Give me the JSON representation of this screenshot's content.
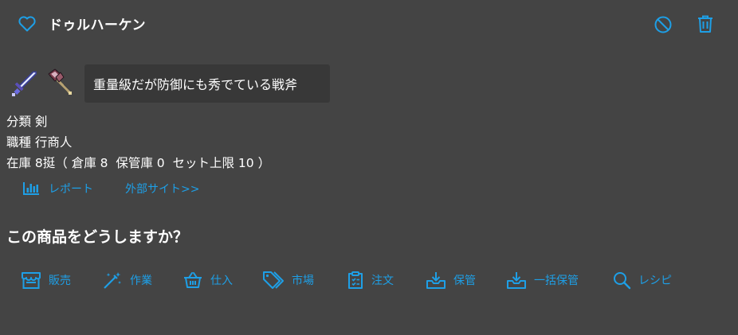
{
  "header": {
    "title": "ドゥルハーケン",
    "favorite_icon": "heart-outline-icon",
    "ban_icon": "ban-icon",
    "delete_icon": "trash-icon"
  },
  "item": {
    "sprites": [
      "sword-sprite",
      "axe-sprite"
    ],
    "description": "重量級だが防御にも秀でている戦斧",
    "category_line": "分類 剣",
    "job_line": "職種 行商人",
    "stock_line": "在庫 8挺（ 倉庫 8  保管庫 0  セット上限 10 ）"
  },
  "links": {
    "report_label": "レポート",
    "external_label": "外部サイト>>"
  },
  "prompt": {
    "question": "この商品をどうしますか？"
  },
  "actions": [
    {
      "label": "販売",
      "icon": "store-icon"
    },
    {
      "label": "作業",
      "icon": "magic-wand-icon"
    },
    {
      "label": "仕入",
      "icon": "basket-icon"
    },
    {
      "label": "市場",
      "icon": "tags-icon"
    },
    {
      "label": "注文",
      "icon": "clipboard-list-icon"
    },
    {
      "label": "保管",
      "icon": "inbox-download-icon"
    },
    {
      "label": "一括保管",
      "icon": "inbox-download-icon"
    },
    {
      "label": "レシピ",
      "icon": "search-icon"
    }
  ],
  "colors": {
    "background": "#444444",
    "accent": "#1e9fe6",
    "description_box": "#383838",
    "text": "#ffffff"
  }
}
